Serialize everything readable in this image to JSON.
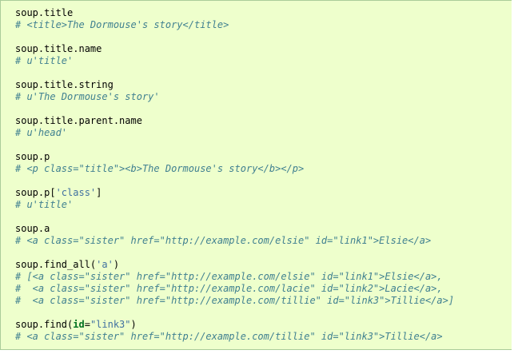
{
  "code": {
    "blocks": [
      {
        "statement": "soup.title",
        "comment": "# <title>The Dormouse's story</title>"
      },
      {
        "statement": "soup.title.name",
        "comment": "# u'title'"
      },
      {
        "statement": "soup.title.string",
        "comment": "# u'The Dormouse's story'"
      },
      {
        "statement": "soup.title.parent.name",
        "comment": "# u'head'"
      },
      {
        "statement": "soup.p",
        "comment": "# <p class=\"title\"><b>The Dormouse's story</b></p>"
      },
      {
        "statement_parts": [
          "soup.p[",
          "'class'",
          "]"
        ],
        "comment": "# u'title'"
      },
      {
        "statement": "soup.a",
        "comment": "# <a class=\"sister\" href=\"http://example.com/elsie\" id=\"link1\">Elsie</a>"
      },
      {
        "statement_parts": [
          "soup.find_all(",
          "'a'",
          ")"
        ],
        "comments": [
          "# [<a class=\"sister\" href=\"http://example.com/elsie\" id=\"link1\">Elsie</a>,",
          "#  <a class=\"sister\" href=\"http://example.com/lacie\" id=\"link2\">Lacie</a>,",
          "#  <a class=\"sister\" href=\"http://example.com/tillie\" id=\"link3\">Tillie</a>]"
        ]
      },
      {
        "statement_parts": [
          "soup.find(",
          "id",
          "=",
          "\"link3\"",
          ")"
        ],
        "comment": "# <a class=\"sister\" href=\"http://example.com/tillie\" id=\"link3\">Tillie</a>"
      }
    ]
  },
  "colors": {
    "background": "#eeffcc",
    "border": "#aacc99",
    "comment": "#408090",
    "string": "#4070a0",
    "keyword": "#007020"
  }
}
